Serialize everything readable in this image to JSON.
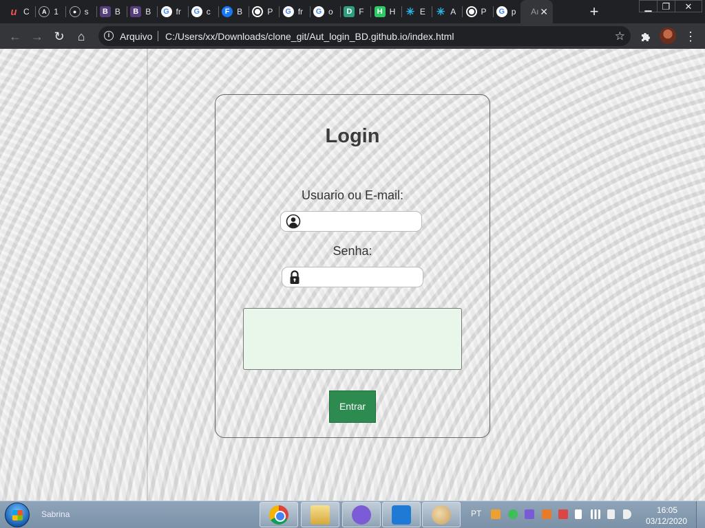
{
  "browser": {
    "tabs": [
      {
        "title": "C",
        "favicon": "udemy-icon",
        "color": "#a435f0",
        "glyph": "u"
      },
      {
        "title": "1",
        "favicon": "angular-icon",
        "color": "#3c3c3c",
        "glyph": "A"
      },
      {
        "title": "s",
        "favicon": "github-icon",
        "color": "#3c3c3c",
        "glyph": "●"
      },
      {
        "title": "B",
        "favicon": "bootstrap-icon",
        "color": "#563d7c",
        "glyph": "B"
      },
      {
        "title": "B",
        "favicon": "bootstrap-icon",
        "color": "#563d7c",
        "glyph": "B"
      },
      {
        "title": "fr",
        "favicon": "google-icon",
        "color": "#4285f4",
        "glyph": "G"
      },
      {
        "title": "c",
        "favicon": "google-icon",
        "color": "#4285f4",
        "glyph": "G"
      },
      {
        "title": "B",
        "favicon": "facebook-icon",
        "color": "#1877f2",
        "glyph": "F"
      },
      {
        "title": "P",
        "favicon": "globe-icon",
        "color": "#ffffff",
        "glyph": ""
      },
      {
        "title": "fr",
        "favicon": "google-icon",
        "color": "#4285f4",
        "glyph": "G"
      },
      {
        "title": "o",
        "favicon": "google-icon",
        "color": "#4285f4",
        "glyph": "G"
      },
      {
        "title": "F",
        "favicon": "devdocs-icon",
        "color": "#2f9e7e",
        "glyph": "D"
      },
      {
        "title": "H",
        "favicon": "hackerrank-icon",
        "color": "#2ec866",
        "glyph": "H"
      },
      {
        "title": "E",
        "favicon": "snowflake-icon",
        "color": "#29b5e8",
        "glyph": "✳"
      },
      {
        "title": "A",
        "favicon": "snowflake-icon",
        "color": "#29b5e8",
        "glyph": "✳"
      },
      {
        "title": "P",
        "favicon": "globe-icon",
        "color": "#ffffff",
        "glyph": ""
      },
      {
        "title": "p",
        "favicon": "google-icon",
        "color": "#4285f4",
        "glyph": "G"
      },
      {
        "title": "Aı",
        "favicon": "none",
        "color": "#35363a",
        "glyph": "",
        "active": true
      }
    ],
    "new_tab": "+",
    "window_controls": {
      "minimize": "▁",
      "maximize": "❐",
      "close": "✕"
    },
    "toolbar": {
      "back": "←",
      "forward": "→",
      "reload": "↻",
      "home": "⌂",
      "security_label": "Arquivo",
      "url": "C:/Users/xx/Downloads/clone_git/Aut_login_BD.github.io/index.html",
      "bookmark_star": "☆",
      "menu": "⋮"
    }
  },
  "page": {
    "title": "Login",
    "user_label": "Usuario ou E-mail:",
    "user_value": "",
    "password_label": "Senha:",
    "password_value": "",
    "message": "",
    "submit_label": "Entrar"
  },
  "taskbar": {
    "user": "Sabrina",
    "apps": [
      "chrome-icon",
      "file-explorer-icon",
      "gitkraken-icon",
      "vscode-icon",
      "paint-icon"
    ],
    "language": "PT",
    "time": "16:05",
    "date": "03/12/2020"
  }
}
